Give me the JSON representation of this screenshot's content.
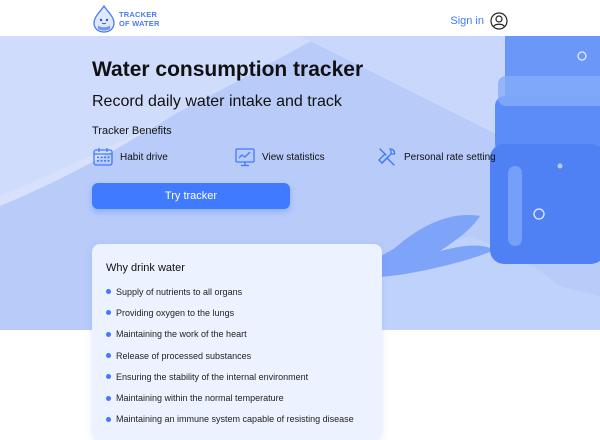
{
  "header": {
    "logo_line1": "TRACKER",
    "logo_line2": "OF WATER",
    "signin_label": "Sign in"
  },
  "hero": {
    "title": "Water consumption tracker",
    "subtitle": "Record daily water intake and track",
    "benefits_title": "Tracker Benefits",
    "benefits": [
      {
        "label": "Habit drive",
        "icon": "calendar-icon"
      },
      {
        "label": "View statistics",
        "icon": "statistics-icon"
      },
      {
        "label": "Personal rate setting",
        "icon": "tools-icon"
      }
    ],
    "cta_label": "Try tracker"
  },
  "why": {
    "title": "Why drink water",
    "items": [
      "Supply of nutrients to all organs",
      "Providing oxygen to the lungs",
      "Maintaining the work of the heart",
      "Release of processed substances",
      "Ensuring the stability of the internal environment",
      "Maintaining within the normal temperature",
      "Maintaining an immune system capable of resisting disease"
    ]
  },
  "colors": {
    "accent": "#407bff",
    "hero_bg": "#d7e1fb",
    "card_bg": "#ecf2ff"
  }
}
